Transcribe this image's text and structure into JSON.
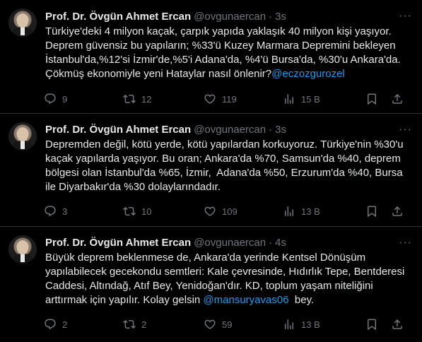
{
  "tweets": [
    {
      "author_name": "Prof. Dr. Övgün Ahmet Ercan",
      "handle": "@ovgunaercan",
      "time": "3s",
      "text": "Türkiye'deki 4 milyon kaçak, çarpık yapıda yaklaşık 40 milyon kişi yaşıyor. Deprem güvensiz bu yapıların; %33'ü Kuzey Marmara Depremini bekleyen İstanbul'da,%12'si İzmir'de,%5'i Adana'da, %4'ü Bursa'da, %30'u Ankara'da. Çökmüş ekonomiyle yeni Hataylar nasıl önlenir?",
      "mention": "@eczozgurozel",
      "text_after": "",
      "replies": "9",
      "retweets": "12",
      "likes": "119",
      "views": "15 B"
    },
    {
      "author_name": "Prof. Dr. Övgün Ahmet Ercan",
      "handle": "@ovgunaercan",
      "time": "3s",
      "text": "Depremden değil, kötü yerde, kötü yapılardan korkuyoruz. Türkiye'nin %30'u kaçak yapılarda yaşıyor. Bu oran; Ankara'da %70, Samsun'da %40, deprem bölgesi olan İstanbul'da %65, İzmir,  Adana'da %50, Erzurum'da %40, Bursa ile Diyarbakır'da %30 dolaylarındadır.",
      "mention": "",
      "text_after": "",
      "replies": "3",
      "retweets": "10",
      "likes": "109",
      "views": "13 B"
    },
    {
      "author_name": "Prof. Dr. Övgün Ahmet Ercan",
      "handle": "@ovgunaercan",
      "time": "4s",
      "text": "Büyük deprem beklenmese de, Ankara'da yerinde Kentsel Dönüşüm yapılabilecek gecekondu semtleri: Kale çevresinde, Hıdırlık Tepe, Bentderesi Caddesi, Altındağ, Atıf Bey, Yenidoğan'dır. KD, toplum yaşam niteliğini arttırmak için yapılır. Kolay gelsin ",
      "mention": "@mansuryavas06",
      "text_after": "  bey.",
      "replies": "2",
      "retweets": "2",
      "likes": "59",
      "views": "13 B"
    }
  ],
  "icons": {
    "more": "more-icon",
    "reply": "reply-icon",
    "retweet": "retweet-icon",
    "like": "like-icon",
    "views": "views-icon",
    "bookmark": "bookmark-icon",
    "share": "share-icon"
  },
  "colors": {
    "background": "#000000",
    "text": "#e7e9ea",
    "muted": "#71767b",
    "link": "#1d9bf0",
    "divider": "#2f3336"
  }
}
